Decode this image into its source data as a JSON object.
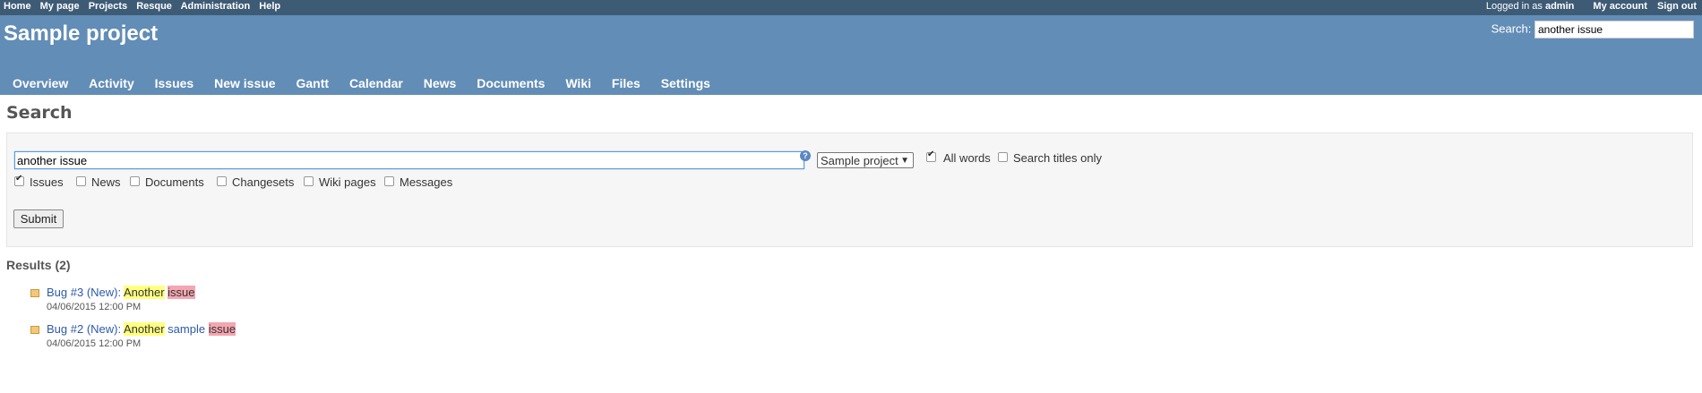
{
  "top_menu": {
    "left": [
      "Home",
      "My page",
      "Projects",
      "Resque",
      "Administration",
      "Help"
    ],
    "logged_in_prefix": "Logged in as",
    "user": "admin",
    "my_account": "My account",
    "sign_out": "Sign out"
  },
  "header": {
    "title": "Sample project",
    "search_label": "Search:",
    "search_value": "another issue",
    "tabs": [
      "Overview",
      "Activity",
      "Issues",
      "New issue",
      "Gantt",
      "Calendar",
      "News",
      "Documents",
      "Wiki",
      "Files",
      "Settings"
    ]
  },
  "page": {
    "title": "Search",
    "query_value": "another issue",
    "help_glyph": "?",
    "scope": "Sample project",
    "all_words": {
      "label": "All words",
      "checked": true
    },
    "titles_only": {
      "label": "Search titles only",
      "checked": false
    },
    "types": [
      {
        "label": "Issues",
        "checked": true
      },
      {
        "label": "News",
        "checked": false
      },
      {
        "label": "Documents",
        "checked": false
      },
      {
        "label": "Changesets",
        "checked": false
      },
      {
        "label": "Wiki pages",
        "checked": false
      },
      {
        "label": "Messages",
        "checked": false
      }
    ],
    "submit": "Submit"
  },
  "results": {
    "title": "Results (2)",
    "items": [
      {
        "prefix": "Bug #3 (New):",
        "hl1": "Another",
        "middle": "",
        "hl2": "issue",
        "date": "04/06/2015 12:00 PM"
      },
      {
        "prefix": "Bug #2 (New):",
        "hl1": "Another",
        "middle": "sample",
        "hl2": "issue",
        "date": "04/06/2015 12:00 PM"
      }
    ]
  },
  "colors": {
    "top_bar": "#3e5b76",
    "header": "#628db6",
    "link": "#2e5aa8",
    "highlight_yellow": "#ffff80",
    "highlight_pink": "#f4a6b1"
  }
}
